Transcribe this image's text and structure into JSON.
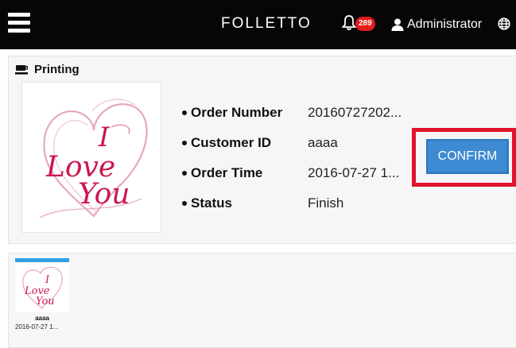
{
  "header": {
    "title": "FOLLETTO",
    "notification_count": "289",
    "user_label": "Administrator"
  },
  "panel": {
    "title": "Printing",
    "image_text": "I Love You",
    "details": [
      {
        "label": "Order Number",
        "value": "20160727202..."
      },
      {
        "label": "Customer ID",
        "value": "aaaa"
      },
      {
        "label": "Order Time",
        "value": "2016-07-27 1..."
      },
      {
        "label": "Status",
        "value": "Finish"
      }
    ],
    "confirm_label": "CONFIRM"
  },
  "queue": {
    "items": [
      {
        "name": "aaaa",
        "time": "2016-07-27 1..."
      }
    ]
  },
  "colors": {
    "topbar": "#060606",
    "badge": "#e21b1b",
    "confirm": "#3e8ad2",
    "highlight_frame": "#e0142b",
    "card_accent": "#2da0e6"
  },
  "icons": [
    "menu-icon",
    "bell-icon",
    "user-icon",
    "globe-icon",
    "printer-icon"
  ]
}
